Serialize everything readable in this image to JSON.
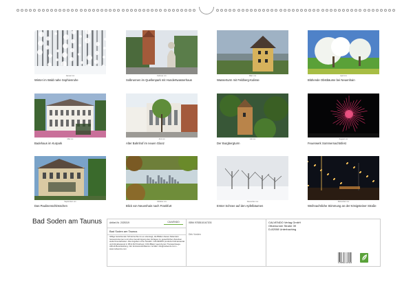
{
  "calendar": {
    "title": "Bad Soden am Taunus"
  },
  "months": [
    {
      "month": "Januar xxx",
      "caption": "Winter im Wald nahe Sophienruhe",
      "scene": "snow-forest"
    },
    {
      "month": "Februar xxx",
      "caption": "Solbrunnen im Quellenpark mit Hundertwasserhaus",
      "scene": "fountain"
    },
    {
      "month": "März xxx",
      "caption": "Wasserturm mit Feldberg-Kulisse",
      "scene": "tower"
    },
    {
      "month": "April xxx",
      "caption": "Blühende Obstbäume bei Neuenhain",
      "scene": "blossom"
    },
    {
      "month": "Mai xxx",
      "caption": "Badehaus im Kurpark",
      "scene": "badehaus"
    },
    {
      "month": "Juni xxx",
      "caption": "Alter Bahnhof im neuen Glanz",
      "scene": "bahnhof"
    },
    {
      "month": "Juli xxx",
      "caption": "Der Burgbergturm",
      "scene": "burgberg"
    },
    {
      "month": "August xxx",
      "caption": "Feuerwerk Sommernachtsfest",
      "scene": "firework"
    },
    {
      "month": "September xxx",
      "caption": "Das Paulinenschlösschen",
      "scene": "villa"
    },
    {
      "month": "Oktober xxx",
      "caption": "Blick von Neuenhain nach Frankfurt",
      "scene": "skyline"
    },
    {
      "month": "November xxx",
      "caption": "Erster Schnee auf den Apfelbäumen",
      "scene": "snow-trees"
    },
    {
      "month": "Dezember xxx",
      "caption": "Weihnachtliche Stimmung an der Königsteiner Straße",
      "scene": "christmas"
    }
  ],
  "info": {
    "article_no": "Artikel-Nr. 2025319",
    "logo_text": "CALVENDO",
    "subtitle": "Bad Soden am Taunus",
    "legal_text": "Idillige bestehender Schutzrechte ist es untersagt, die Blätter dieses Kalenders herauszutrennen und ohne Genehmigung des Verlages zu gewerblichen Zwecken weiterzuverarbeiten. Alle Angaben ohne Gewähr. CALVENDO produziert klimaneutral und klimabewusst in D8 & D2 Positivum CO2-Bilanz seed Aurum Transportwege. Abholt-Bereitstellung, inkl. Emissionsbrillanzen. E-Mail: info@calvendo.com • www.calvendo.com",
    "isbn": "ISBN 9783510167203",
    "author": "Dirk Vorden",
    "publisher_lines": [
      "CALVENDO Verlag GmbH",
      "Ottobrunner Straße 39",
      "D-82008 Unterhaching"
    ],
    "barcode_number": "9 783510 107203"
  },
  "colors": {
    "border": "#cccccc",
    "eco_badge": "#5aa23a"
  }
}
